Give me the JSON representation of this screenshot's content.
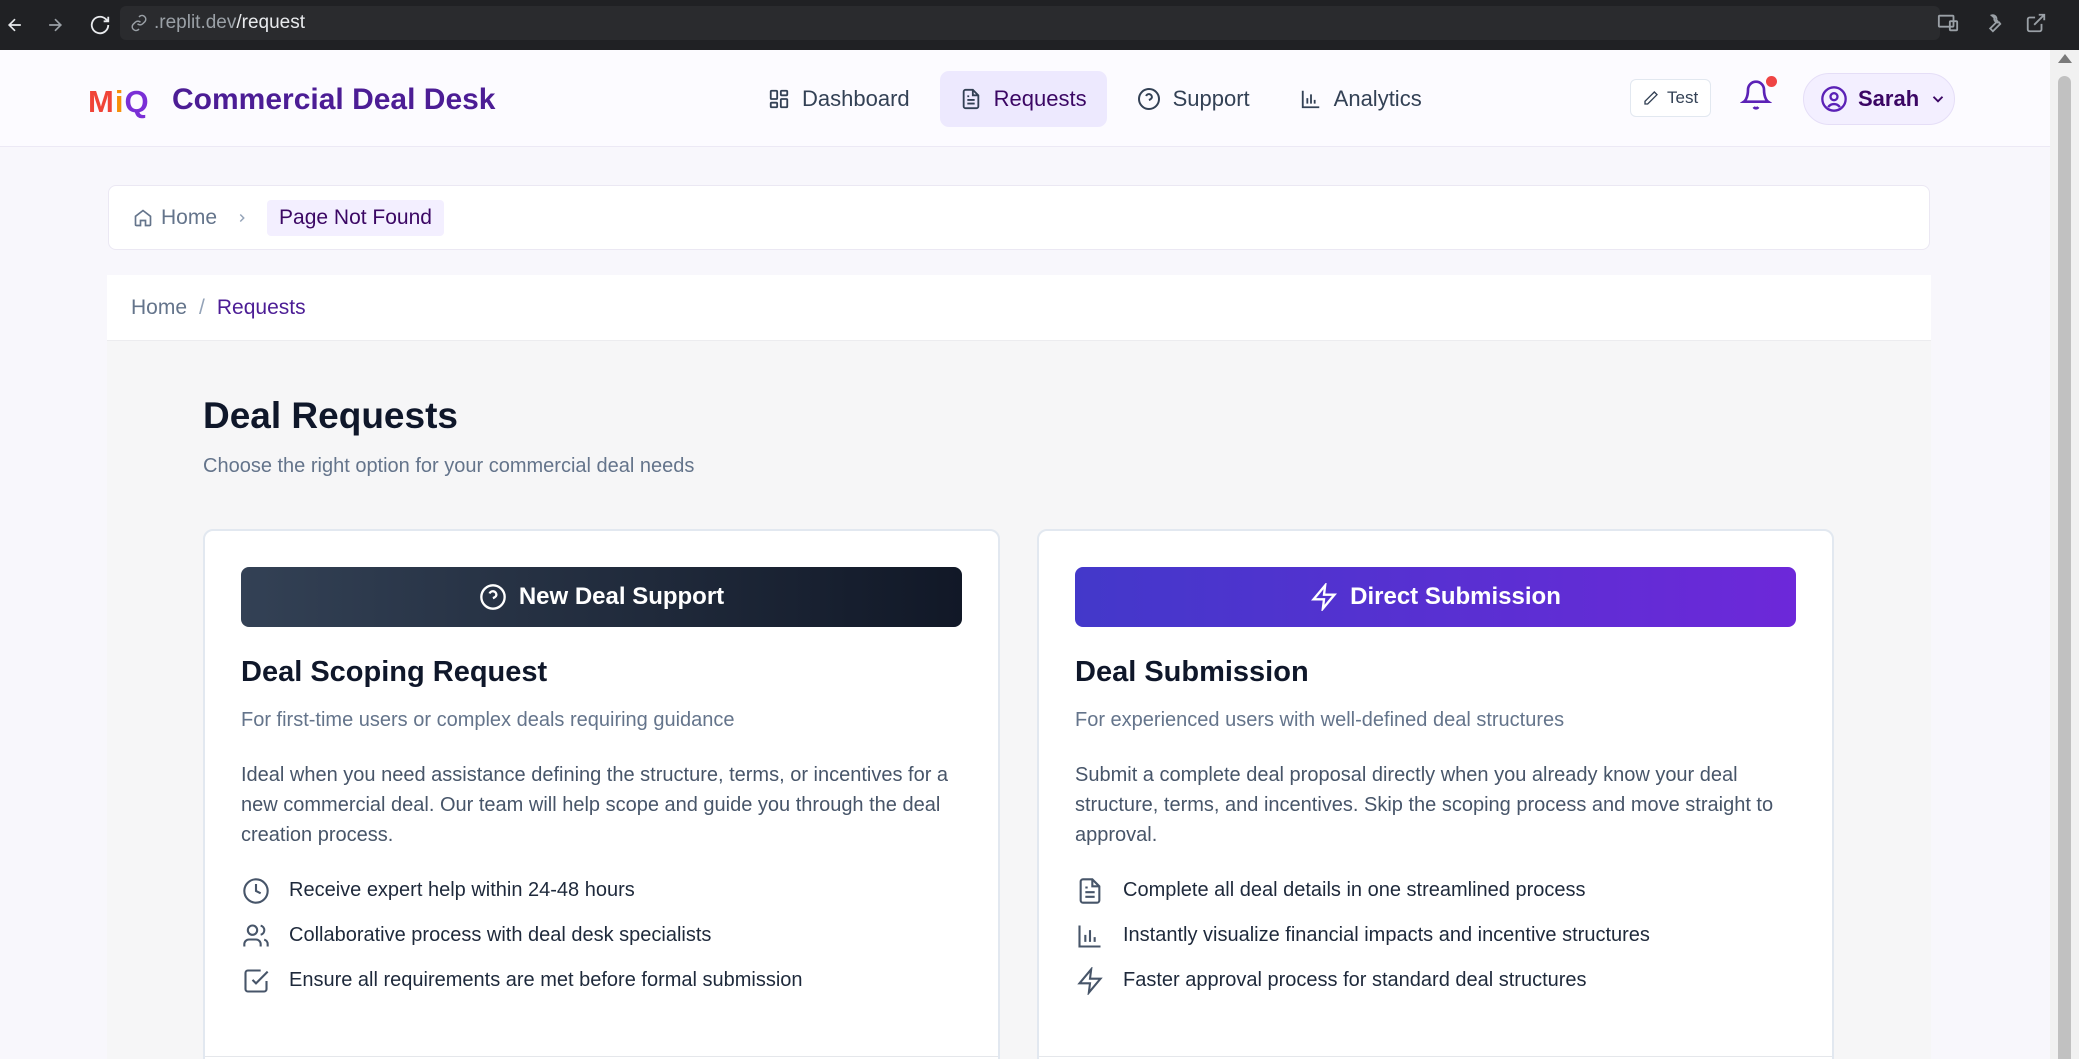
{
  "browser": {
    "url_prefix": ".replit.dev",
    "url_path": "/request"
  },
  "header": {
    "logo_m": "M",
    "logo_i": "i",
    "logo_q": "Q",
    "app_title": "Commercial Deal Desk",
    "nav": [
      {
        "label": "Dashboard",
        "icon": "dashboard-icon",
        "active": false
      },
      {
        "label": "Requests",
        "icon": "file-text-icon",
        "active": true
      },
      {
        "label": "Support",
        "icon": "help-circle-icon",
        "active": false
      },
      {
        "label": "Analytics",
        "icon": "bar-chart-icon",
        "active": false
      }
    ],
    "test_label": "Test",
    "user_name": "Sarah",
    "notification_dot_color": "#ef4444"
  },
  "breadcrumb_top": {
    "home": "Home",
    "current": "Page Not Found"
  },
  "breadcrumb_panel": {
    "home": "Home",
    "separator": "/",
    "current": "Requests"
  },
  "page": {
    "title": "Deal Requests",
    "subtitle": "Choose the right option for your commercial deal needs"
  },
  "cards": {
    "left": {
      "button_label": "New Deal Support",
      "button_icon": "help-circle-icon",
      "title": "Deal Scoping Request",
      "subtitle": "For first-time users or complex deals requiring guidance",
      "description": "Ideal when you need assistance defining the structure, terms, or incentives for a new commercial deal. Our team will help scope and guide you through the deal creation process.",
      "features": [
        {
          "icon": "clock-icon",
          "text": "Receive expert help within 24-48 hours"
        },
        {
          "icon": "users-icon",
          "text": "Collaborative process with deal desk specialists"
        },
        {
          "icon": "check-square-icon",
          "text": "Ensure all requirements are met before formal submission"
        }
      ]
    },
    "right": {
      "button_label": "Direct Submission",
      "button_icon": "lightning-icon",
      "title": "Deal Submission",
      "subtitle": "For experienced users with well-defined deal structures",
      "description": "Submit a complete deal proposal directly when you already know your deal structure, terms, and incentives. Skip the scoping process and move straight to approval.",
      "features": [
        {
          "icon": "file-text-icon",
          "text": "Complete all deal details in one streamlined process"
        },
        {
          "icon": "bar-chart-icon",
          "text": "Instantly visualize financial impacts and incentive structures"
        },
        {
          "icon": "lightning-icon",
          "text": "Faster approval process for standard deal structures"
        }
      ]
    }
  }
}
